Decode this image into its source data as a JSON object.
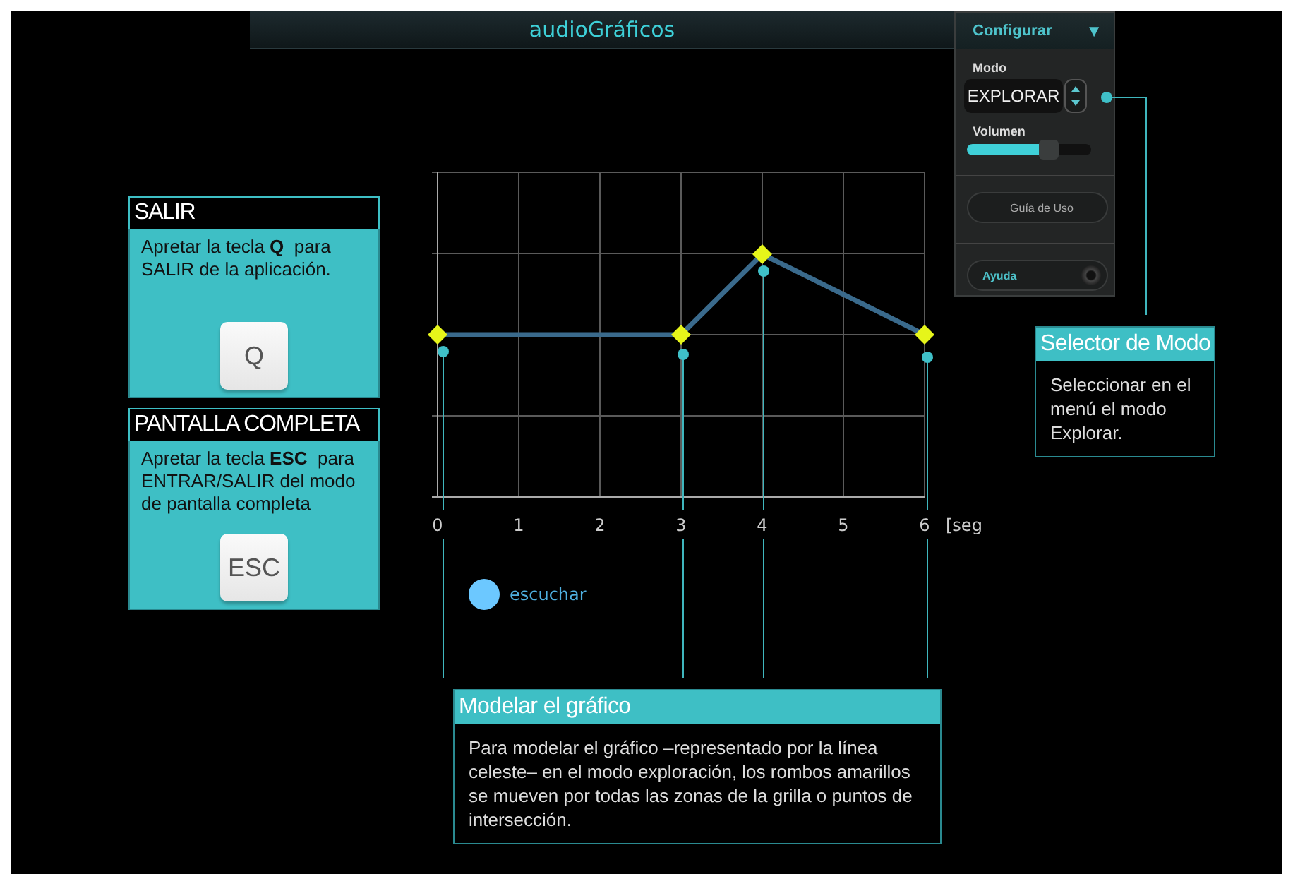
{
  "title_bar": {
    "title": "audioGráficos"
  },
  "config_panel": {
    "header": "Configurar",
    "expand_glyph": "▼",
    "mode_label": "Modo",
    "mode_value": "EXPLORAR",
    "volume_label": "Volumen",
    "volume": {
      "level": 0.72
    },
    "guide_button": "Guía de Uso",
    "help_button": "Ayuda"
  },
  "graph": {
    "x_labels": [
      "0",
      "1",
      "2",
      "3",
      "4",
      "5",
      "6"
    ],
    "x_unit": "[seg"
  },
  "listen_button": {
    "label": "escuchar"
  },
  "callouts": [
    {
      "kind": "key",
      "title": "SALIR",
      "text": "Apretar la tecla **Q**  para SALIR de la aplicación.",
      "key": "Q"
    },
    {
      "kind": "key",
      "title": "PANTALLA COMPLETA",
      "text": "Apretar la tecla **ESC**  para ENTRAR/SALIR del modo de pantalla completa",
      "key": "ESC"
    },
    {
      "kind": "note",
      "title": "Selector de Modo",
      "text": "Seleccionar en el menú el modo Explorar."
    },
    {
      "kind": "note",
      "title": "Modelar el gráfico",
      "text": "Para modelar el gráfico –representado por la línea celeste– en el modo exploración, los rombos amarillos se mueven por todas las zonas de la grilla o puntos de intersección."
    }
  ]
}
